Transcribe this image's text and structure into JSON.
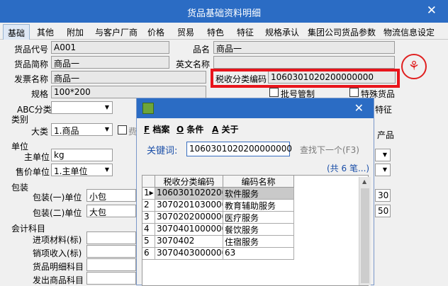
{
  "window": {
    "title": "货品基础资料明细",
    "close": "✕"
  },
  "tabs": [
    "基础",
    "其他",
    "附加",
    "与客户厂商",
    "价格",
    "贸易",
    "特色",
    "特征",
    "规格承认",
    "集团公司货品参数",
    "物流信息设定"
  ],
  "form": {
    "code_label": "货品代号",
    "code_value": "A001",
    "name_label": "品名",
    "name_value": "商品一",
    "short_label": "货品简称",
    "short_value": "商品一",
    "en_label": "英文名称",
    "invoice_label": "发票名称",
    "invoice_value": "商品一",
    "tax_label": "税收分类编码",
    "tax_value": "1060301020200000000",
    "spec_label": "规格",
    "spec_value": "100*200",
    "abc_label": "ABC分类",
    "batch_label": "批号管制",
    "special_label": "特殊货品",
    "feature_label": "特征",
    "category_label": "类别",
    "major_label": "大类",
    "major_value": "1.商品",
    "fee_label": "费",
    "product_label": "产品",
    "unit_section": "单位",
    "main_unit_label": "主单位",
    "main_unit_value": "kg",
    "sale_unit_label": "售价单位",
    "sale_unit_value": "1.主单位",
    "pack_section": "包装",
    "pack1_label": "包装(一)单位",
    "pack1_value": "小包",
    "pack1_qty": "30",
    "pack2_label": "包装(二)单位",
    "pack2_value": "大包",
    "pack2_qty": "50",
    "account_section": "会计科目",
    "acc1": "进项材料(标)",
    "acc2": "销项收入(标)",
    "acc3": "货品明细科目",
    "acc4": "发出商品科目"
  },
  "dialog": {
    "menu": [
      {
        "key": "F",
        "label": "档案"
      },
      {
        "key": "O",
        "label": "条件"
      },
      {
        "key": "A",
        "label": "关于"
      }
    ],
    "keyword_label": "关键词:",
    "keyword_value": "1060301020200000000",
    "find_next": "查找下一个(F3)",
    "count": "(共 6 笔...)",
    "columns": [
      "税收分类编码",
      "编码名称"
    ],
    "rows": [
      {
        "num": "1",
        "code": "1060301020200",
        "name": "软件服务"
      },
      {
        "num": "2",
        "code": "3070201030000",
        "name": "教育辅助服务"
      },
      {
        "num": "3",
        "code": "3070202000000",
        "name": "医疗服务"
      },
      {
        "num": "4",
        "code": "3070401000000",
        "name": "餐饮服务"
      },
      {
        "num": "5",
        "code": "3070402",
        "name": "住宿服务"
      },
      {
        "num": "6",
        "code": "3070403000000",
        "name": "63"
      }
    ]
  },
  "colors": {
    "titlebar": "#2b6cc4",
    "highlight_border": "#e8141b",
    "stamp": "#e02020"
  }
}
